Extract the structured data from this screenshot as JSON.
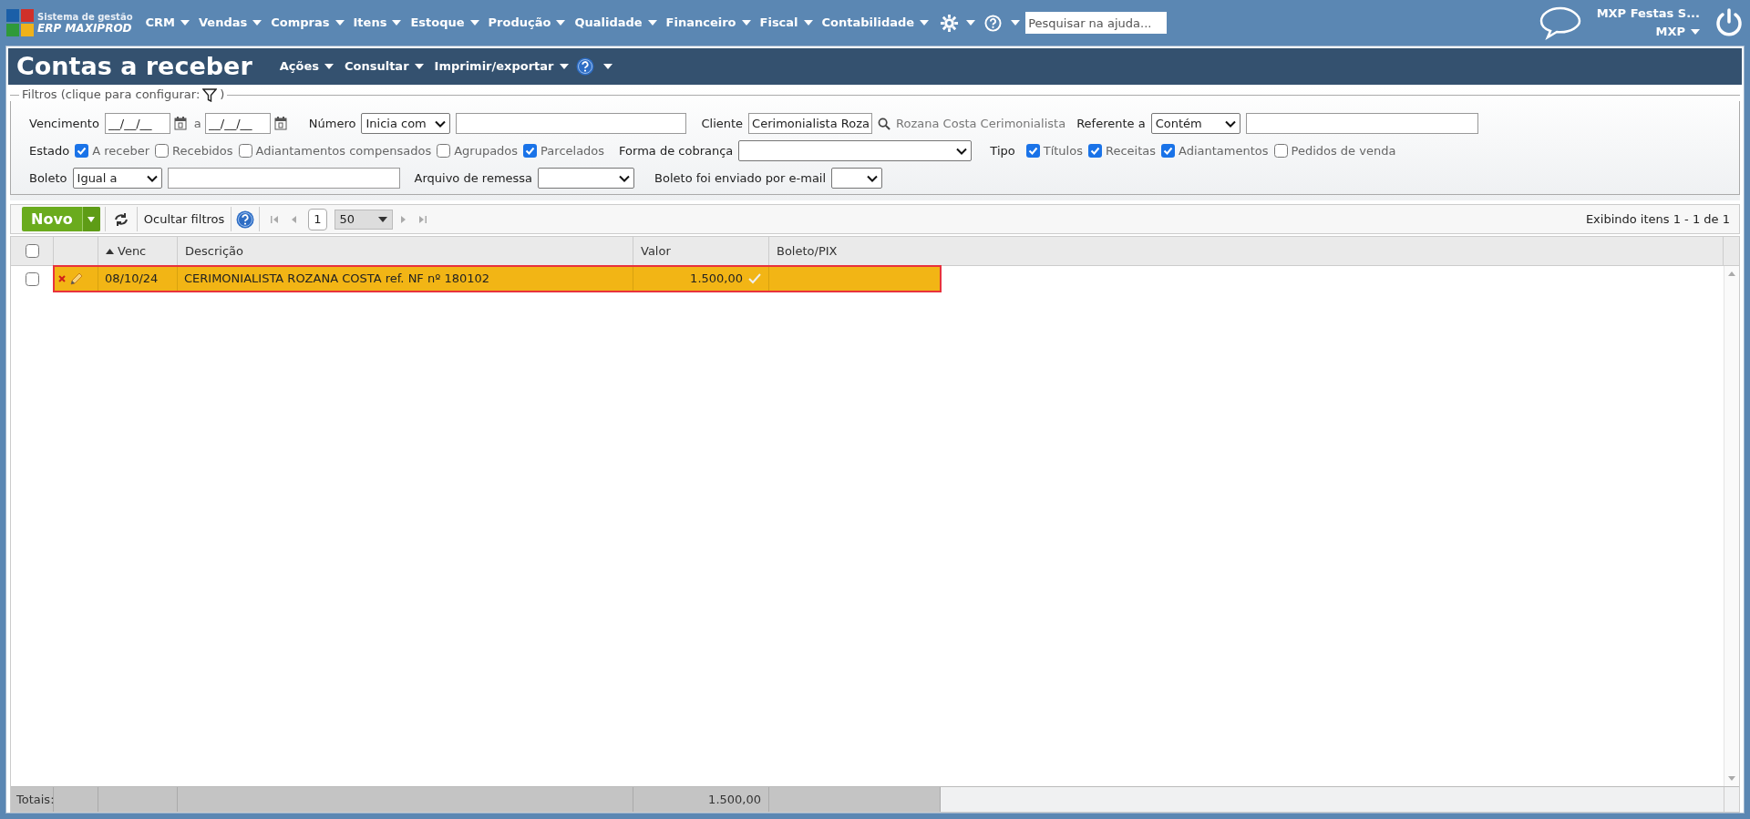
{
  "app": {
    "logo_line1": "Sistema de gestão",
    "logo_line2": "ERP MAXIPROD",
    "menus": [
      "CRM",
      "Vendas",
      "Compras",
      "Itens",
      "Estoque",
      "Produção",
      "Qualidade",
      "Financeiro",
      "Fiscal",
      "Contabilidade"
    ],
    "search_placeholder": "Pesquisar na ajuda...",
    "user": "MXP Festas S...",
    "company": "MXP"
  },
  "page": {
    "title": "Contas a receber",
    "menus": [
      "Ações",
      "Consultar",
      "Imprimir/exportar"
    ]
  },
  "filters": {
    "legend": "Filtros (clique para configurar:",
    "legend_end": ")",
    "vencimento": {
      "label": "Vencimento",
      "from": "__/__/__",
      "sep": "a",
      "to": "__/__/__"
    },
    "numero": {
      "label": "Número",
      "select": "Inicia com"
    },
    "cliente": {
      "label": "Cliente",
      "value": "Cerimonialista Roza",
      "name": "Rozana Costa Cerimonialista"
    },
    "referente": {
      "label": "Referente a",
      "select": "Contém"
    },
    "estado": {
      "label": "Estado",
      "options": [
        {
          "label": "A receber",
          "checked": true
        },
        {
          "label": "Recebidos",
          "checked": false
        },
        {
          "label": "Adiantamentos compensados",
          "checked": false
        },
        {
          "label": "Agrupados",
          "checked": false
        },
        {
          "label": "Parcelados",
          "checked": true
        }
      ]
    },
    "forma": {
      "label": "Forma de cobrança"
    },
    "tipo": {
      "label": "Tipo",
      "options": [
        {
          "label": "Títulos",
          "checked": true
        },
        {
          "label": "Receitas",
          "checked": true
        },
        {
          "label": "Adiantamentos",
          "checked": true
        },
        {
          "label": "Pedidos de venda",
          "checked": false
        }
      ]
    },
    "boleto": {
      "label": "Boleto",
      "select": "Igual a"
    },
    "arquivo": {
      "label": "Arquivo de remessa"
    },
    "enviado": {
      "label": "Boleto foi enviado por e-mail"
    }
  },
  "toolbar": {
    "new_button": "Novo",
    "hide_filters": "Ocultar filtros",
    "page": "1",
    "page_size": "50",
    "summary": "Exibindo itens 1 - 1 de 1"
  },
  "table": {
    "select_all_checked": false,
    "columns": [
      {
        "label": "Venc",
        "sort_ascending": true
      },
      {
        "label": "Descrição"
      },
      {
        "label": "Valor"
      },
      {
        "label": "Boleto/PIX"
      }
    ],
    "rows": [
      {
        "selected": true,
        "checked": false,
        "venc": "08/10/24",
        "descricao": "CERIMONIALISTA ROZANA COSTA ref. NF nº 180102",
        "valor": "1.500,00",
        "confirmed": true
      }
    ],
    "totals": {
      "label": "Totais:",
      "valor": "1.500,00"
    }
  }
}
